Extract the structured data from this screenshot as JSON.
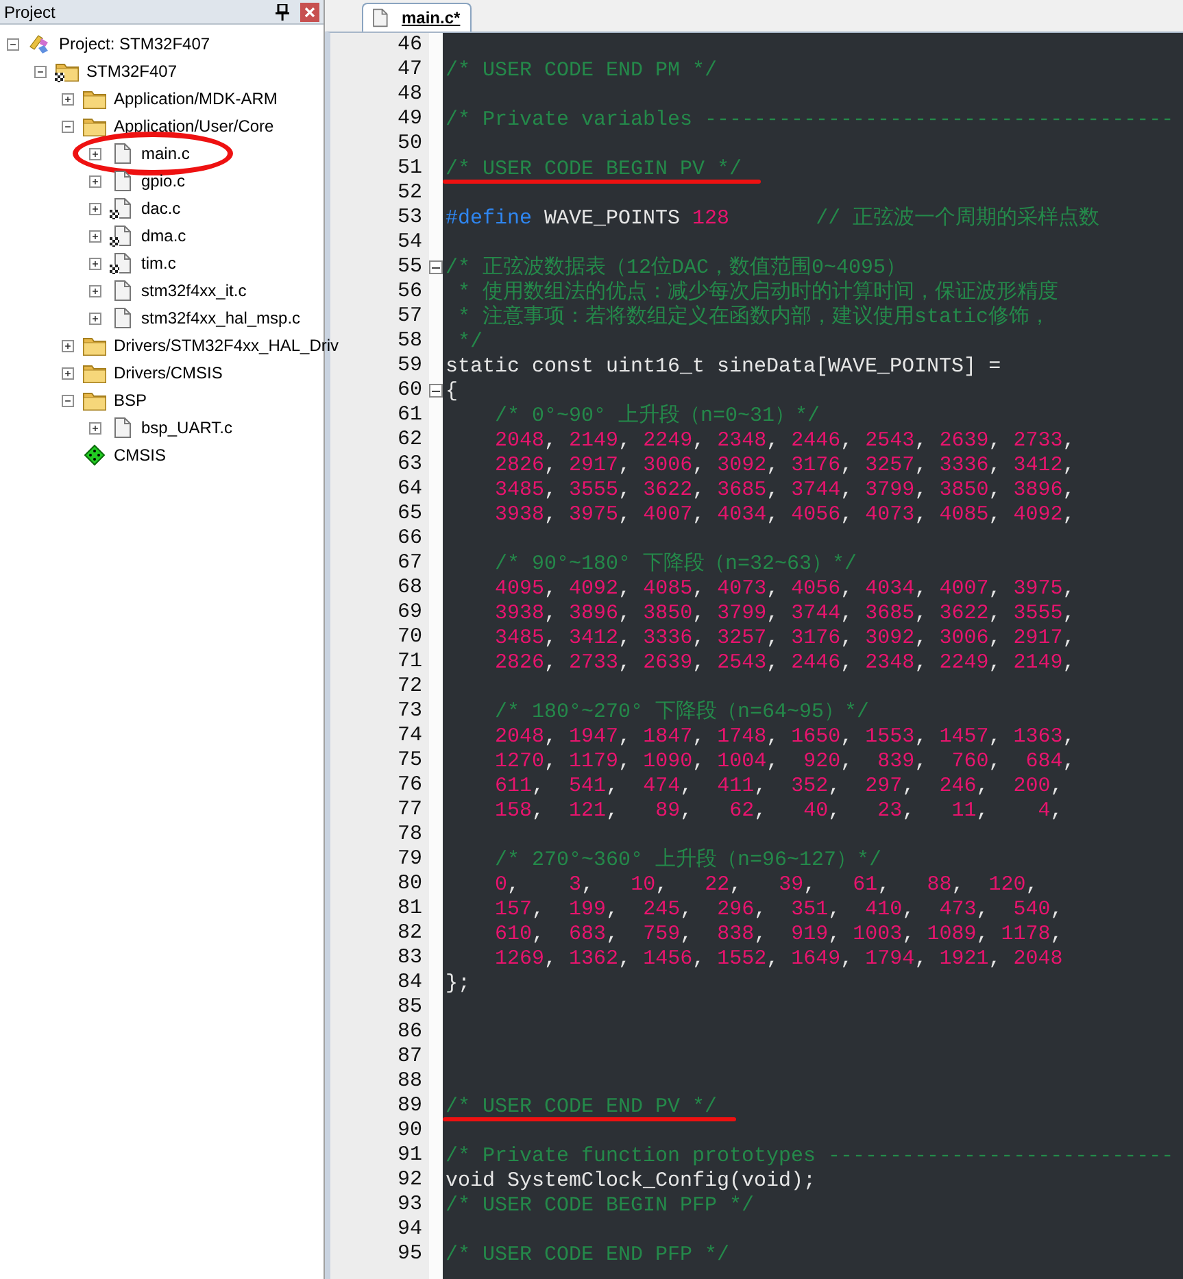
{
  "panel": {
    "title": "Project"
  },
  "tree": [
    {
      "label": "Project: STM32F407",
      "kind": "project",
      "expanded": true,
      "children": [
        {
          "label": "STM32F407",
          "kind": "target",
          "expanded": true,
          "children": [
            {
              "label": "Application/MDK-ARM",
              "kind": "folder",
              "expanded": false
            },
            {
              "label": "Application/User/Core",
              "kind": "folder",
              "expanded": true,
              "children": [
                {
                  "label": "main.c",
                  "kind": "file",
                  "expanded": false,
                  "circled": true
                },
                {
                  "label": "gpio.c",
                  "kind": "file",
                  "expanded": false,
                  "circled": false
                },
                {
                  "label": "dac.c",
                  "kind": "config-file",
                  "expanded": false,
                  "circled": false
                },
                {
                  "label": "dma.c",
                  "kind": "config-file",
                  "expanded": false,
                  "circled": false
                },
                {
                  "label": "tim.c",
                  "kind": "config-file",
                  "expanded": false,
                  "circled": false
                },
                {
                  "label": "stm32f4xx_it.c",
                  "kind": "file",
                  "expanded": false,
                  "circled": false
                },
                {
                  "label": "stm32f4xx_hal_msp.c",
                  "kind": "file",
                  "expanded": false,
                  "circled": false
                }
              ]
            },
            {
              "label": "Drivers/STM32F4xx_HAL_Driv",
              "kind": "folder",
              "expanded": false
            },
            {
              "label": "Drivers/CMSIS",
              "kind": "folder",
              "expanded": false
            },
            {
              "label": "BSP",
              "kind": "folder",
              "expanded": true,
              "children": [
                {
                  "label": "bsp_UART.c",
                  "kind": "file",
                  "expanded": false,
                  "circled": false
                }
              ]
            },
            {
              "label": "CMSIS",
              "kind": "component"
            }
          ]
        }
      ]
    }
  ],
  "editor": {
    "tabs": [
      {
        "label": "main.c*",
        "selected": true
      }
    ],
    "lines": [
      {
        "n": "46",
        "kind": "blank",
        "underlined": false
      },
      {
        "n": "47",
        "kind": "comment",
        "text": "/* USER CODE END PM */",
        "underlined": false
      },
      {
        "n": "48",
        "kind": "blank",
        "underlined": false
      },
      {
        "n": "49",
        "kind": "comment",
        "text": "/* Private variables --------------------------------------",
        "underlined": false
      },
      {
        "n": "50",
        "kind": "blank",
        "underlined": false
      },
      {
        "n": "51",
        "kind": "comment",
        "text": "/* USER CODE BEGIN PV */",
        "underlined": true
      },
      {
        "n": "52",
        "kind": "blank",
        "underlined": false
      },
      {
        "n": "53",
        "kind": "define",
        "segments": [
          {
            "kind": "keyword",
            "text": "#define"
          },
          {
            "kind": "plain",
            "text": " WAVE_POINTS "
          },
          {
            "kind": "number",
            "text": "128"
          },
          {
            "kind": "comment",
            "text": "       // 正弦波一个周期的采样点数"
          }
        ],
        "underlined": false
      },
      {
        "n": "54",
        "kind": "blank",
        "underlined": false
      },
      {
        "n": "55",
        "kind": "comment",
        "text": "/* 正弦波数据表（12位DAC，数值范围0~4095）",
        "collapsed": false,
        "underlined": false
      },
      {
        "n": "56",
        "kind": "comment",
        "text": " * 使用数组法的优点：减少每次启动时的计算时间，保证波形精度",
        "underlined": false
      },
      {
        "n": "57",
        "kind": "comment",
        "text": " * 注意事项：若将数组定义在函数内部，建议使用static修饰，",
        "underlined": false
      },
      {
        "n": "58",
        "kind": "comment",
        "text": " */",
        "underlined": false
      },
      {
        "n": "59",
        "kind": "code",
        "text": "static const uint16_t sineData[WAVE_POINTS] =",
        "underlined": false
      },
      {
        "n": "60",
        "kind": "code",
        "text": "{",
        "collapsed": false,
        "underlined": false
      },
      {
        "n": "61",
        "kind": "comment",
        "text": "    /* 0°~90° 上升段（n=0~31）*/",
        "underlined": false
      },
      {
        "n": "62",
        "kind": "data",
        "text": "    2048, 2149, 2249, 2348, 2446, 2543, 2639, 2733,",
        "underlined": false
      },
      {
        "n": "63",
        "kind": "data",
        "text": "    2826, 2917, 3006, 3092, 3176, 3257, 3336, 3412,",
        "underlined": false
      },
      {
        "n": "64",
        "kind": "data",
        "text": "    3485, 3555, 3622, 3685, 3744, 3799, 3850, 3896,",
        "underlined": false
      },
      {
        "n": "65",
        "kind": "data",
        "text": "    3938, 3975, 4007, 4034, 4056, 4073, 4085, 4092,",
        "underlined": false
      },
      {
        "n": "66",
        "kind": "blank",
        "underlined": false
      },
      {
        "n": "67",
        "kind": "comment",
        "text": "    /* 90°~180° 下降段（n=32~63）*/",
        "underlined": false
      },
      {
        "n": "68",
        "kind": "data",
        "text": "    4095, 4092, 4085, 4073, 4056, 4034, 4007, 3975,",
        "underlined": false
      },
      {
        "n": "69",
        "kind": "data",
        "text": "    3938, 3896, 3850, 3799, 3744, 3685, 3622, 3555,",
        "underlined": false
      },
      {
        "n": "70",
        "kind": "data",
        "text": "    3485, 3412, 3336, 3257, 3176, 3092, 3006, 2917,",
        "underlined": false
      },
      {
        "n": "71",
        "kind": "data",
        "text": "    2826, 2733, 2639, 2543, 2446, 2348, 2249, 2149,",
        "underlined": false
      },
      {
        "n": "72",
        "kind": "blank",
        "underlined": false
      },
      {
        "n": "73",
        "kind": "comment",
        "text": "    /* 180°~270° 下降段（n=64~95）*/",
        "underlined": false
      },
      {
        "n": "74",
        "kind": "data",
        "text": "    2048, 1947, 1847, 1748, 1650, 1553, 1457, 1363,",
        "underlined": false
      },
      {
        "n": "75",
        "kind": "data",
        "text": "    1270, 1179, 1090, 1004,  920,  839,  760,  684,",
        "underlined": false
      },
      {
        "n": "76",
        "kind": "data",
        "text": "    611,  541,  474,  411,  352,  297,  246,  200,",
        "underlined": false
      },
      {
        "n": "77",
        "kind": "data",
        "text": "    158,  121,   89,   62,   40,   23,   11,    4,",
        "underlined": false
      },
      {
        "n": "78",
        "kind": "blank",
        "underlined": false
      },
      {
        "n": "79",
        "kind": "comment",
        "text": "    /* 270°~360° 上升段（n=96~127）*/",
        "underlined": false
      },
      {
        "n": "80",
        "kind": "data",
        "text": "    0,    3,   10,   22,   39,   61,   88,  120,",
        "underlined": false
      },
      {
        "n": "81",
        "kind": "data",
        "text": "    157,  199,  245,  296,  351,  410,  473,  540,",
        "underlined": false
      },
      {
        "n": "82",
        "kind": "data",
        "text": "    610,  683,  759,  838,  919, 1003, 1089, 1178,",
        "underlined": false
      },
      {
        "n": "83",
        "kind": "data",
        "text": "    1269, 1362, 1456, 1552, 1649, 1794, 1921, 2048",
        "underlined": false
      },
      {
        "n": "84",
        "kind": "code",
        "text": "};",
        "underlined": false
      },
      {
        "n": "85",
        "kind": "blank",
        "underlined": false
      },
      {
        "n": "86",
        "kind": "blank",
        "underlined": false
      },
      {
        "n": "87",
        "kind": "blank",
        "underlined": false
      },
      {
        "n": "88",
        "kind": "blank",
        "underlined": false
      },
      {
        "n": "89",
        "kind": "comment",
        "text": "/* USER CODE END PV */",
        "underlined": true
      },
      {
        "n": "90",
        "kind": "blank",
        "underlined": false
      },
      {
        "n": "91",
        "kind": "comment",
        "text": "/* Private function prototypes ----------------------------",
        "underlined": false
      },
      {
        "n": "92",
        "kind": "code",
        "text": "void SystemClock_Config(void);",
        "underlined": false
      },
      {
        "n": "93",
        "kind": "comment",
        "text": "/* USER CODE BEGIN PFP */",
        "underlined": false
      },
      {
        "n": "94",
        "kind": "blank",
        "underlined": false
      },
      {
        "n": "95",
        "kind": "comment",
        "text": "/* USER CODE END PFP */",
        "underlined": false
      }
    ]
  }
}
